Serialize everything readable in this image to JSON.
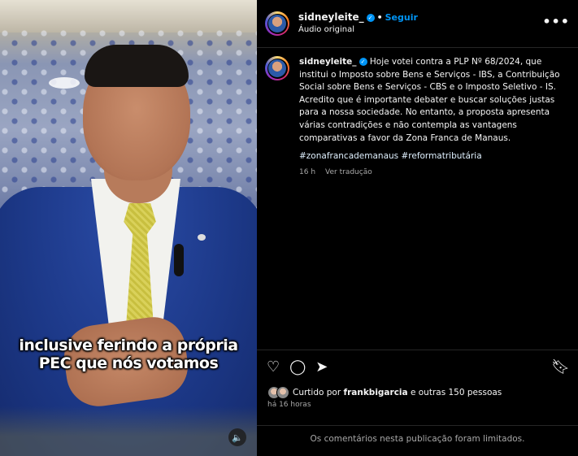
{
  "video": {
    "caption_line1": "inclusive ferindo a própria",
    "caption_line2": "PEC que nós votamos",
    "audio_icon": "speaker-icon"
  },
  "header": {
    "username": "sidneyleite_",
    "verified_icon": "verified-badge-icon",
    "separator": "•",
    "follow_label": "Seguir",
    "audio_label": "Áudio original",
    "more_icon": "more-options-icon"
  },
  "post": {
    "username": "sidneyleite_",
    "caption": "Hoje votei contra a PLP Nº 68/2024, que institui o Imposto sobre Bens e Serviços - IBS, a Contribuição Social sobre Bens e Serviços - CBS e o Imposto Seletivo - IS. Acredito que é importante debater e buscar soluções justas para a nossa sociedade. No entanto, a proposta apresenta várias contradições e não contempla as vantagens comparativas a favor da Zona Franca de Manaus.",
    "hashtags": "#zonafrancademanaus #reformatributária",
    "time_ago": "16 h",
    "translate_label": "Ver tradução"
  },
  "actions": {
    "like_icon": "heart-icon",
    "comment_icon": "comment-icon",
    "share_icon": "share-icon",
    "save_icon": "bookmark-icon",
    "likes_prefix": "Curtido por",
    "likes_user": "frankbigarcia",
    "likes_suffix": "e outras 150 pessoas",
    "posted_time": "há 16 horas",
    "comments_limited": "Os comentários nesta publicação foram limitados."
  }
}
